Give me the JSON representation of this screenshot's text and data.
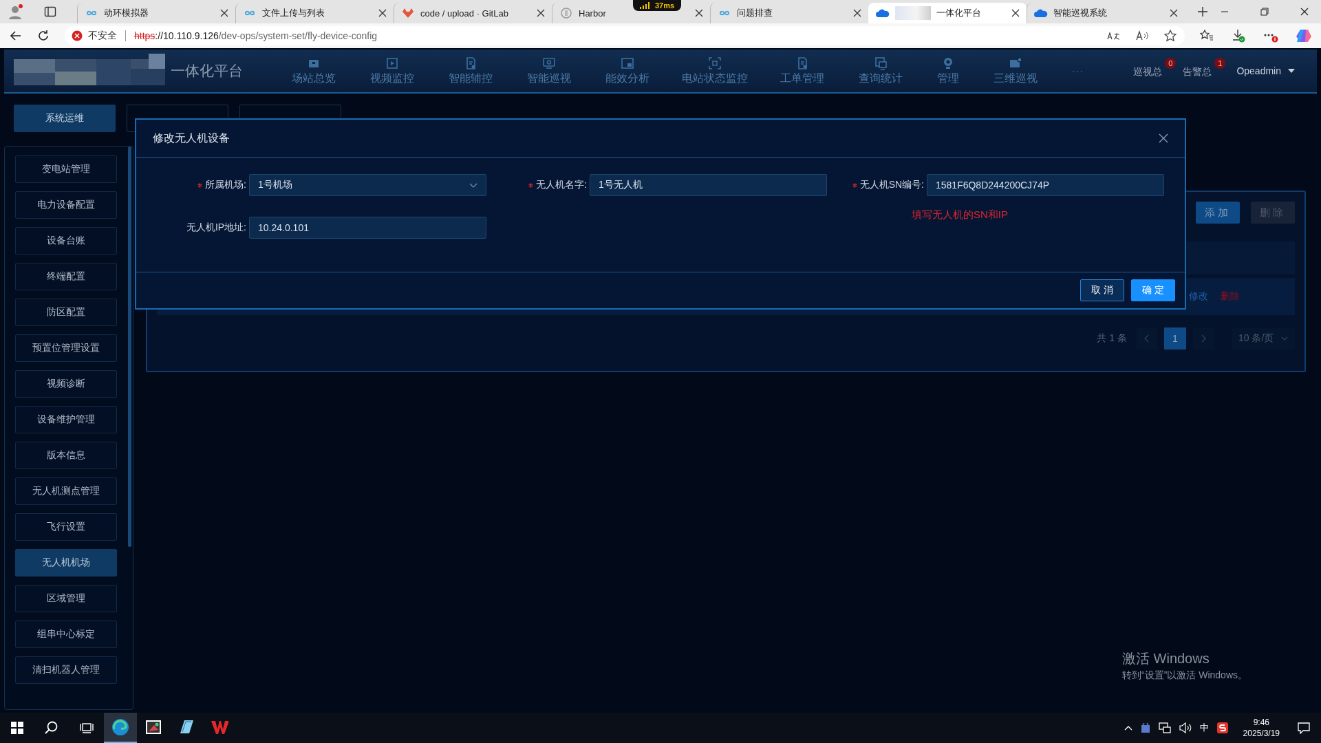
{
  "browser": {
    "tabs": [
      {
        "title": "动环模拟器",
        "kind": "loop",
        "selected": false
      },
      {
        "title": "文件上传与列表",
        "kind": "loop",
        "selected": false
      },
      {
        "title": "code / upload · GitLab",
        "kind": "fox",
        "selected": false
      },
      {
        "title": "Harbor",
        "kind": "circle",
        "selected": false
      },
      {
        "title": "问题排查",
        "kind": "loop",
        "selected": false
      },
      {
        "title": "一体化平台",
        "kind": "cloud",
        "selected": true
      },
      {
        "title": "智能巡视系统",
        "kind": "cloud",
        "selected": false
      }
    ],
    "latency": "37ms",
    "security": "不安全",
    "url": {
      "scheme": "https",
      "host": "://10.110.9.126",
      "path": "/dev-ops/system-set/fly-device-config"
    }
  },
  "header": {
    "title": "一体化平台",
    "nav": [
      {
        "label": "场站总览",
        "kind": "box"
      },
      {
        "label": "视频监控",
        "kind": "play"
      },
      {
        "label": "智能辅控",
        "kind": "doc"
      },
      {
        "label": "智能巡视",
        "kind": "screen"
      },
      {
        "label": "能效分析",
        "kind": "window"
      },
      {
        "label": "电站状态监控",
        "kind": "scan"
      },
      {
        "label": "工单管理",
        "kind": "doc"
      },
      {
        "label": "查询统计",
        "kind": "monitor"
      },
      {
        "label": "管理",
        "kind": "pin"
      },
      {
        "label": "三维巡视",
        "kind": "cam"
      }
    ],
    "more": "···",
    "counters": [
      {
        "label": "巡视总",
        "count": "0"
      },
      {
        "label": "告警总",
        "count": "1"
      }
    ],
    "user": "Opeadmin"
  },
  "top_tabs": [
    {
      "label": "系统运维",
      "selected": true
    },
    {
      "selected": false
    },
    {
      "selected": false
    }
  ],
  "sidebar": {
    "items": [
      {
        "label": "变电站管理",
        "selected": false
      },
      {
        "label": "电力设备配置",
        "selected": false
      },
      {
        "label": "设备台账",
        "selected": false
      },
      {
        "label": "终端配置",
        "selected": false
      },
      {
        "label": "防区配置",
        "selected": false
      },
      {
        "label": "预置位管理设置",
        "selected": false
      },
      {
        "label": "视频诊断",
        "selected": false
      },
      {
        "label": "设备维护管理",
        "selected": false
      },
      {
        "label": "版本信息",
        "selected": false
      },
      {
        "label": "无人机测点管理",
        "selected": false
      },
      {
        "label": "飞行设置",
        "selected": false
      },
      {
        "label": "无人机机场",
        "selected": true
      },
      {
        "label": "区域管理",
        "selected": false
      },
      {
        "label": "组串中心标定",
        "selected": false
      },
      {
        "label": "清扫机器人管理",
        "selected": false
      }
    ]
  },
  "panel": {
    "buttons": [
      {
        "label": "添加",
        "disabled": false
      },
      {
        "label": "删除",
        "disabled": true
      }
    ],
    "row_actions": [
      {
        "label": "修改",
        "kind": "edit"
      },
      {
        "label": "删除",
        "kind": "delete"
      }
    ],
    "pagination": {
      "total": "共 1 条",
      "pages": [
        {
          "label": "1",
          "selected": true
        }
      ],
      "page_size": "10 条/页"
    }
  },
  "dialog": {
    "title": "修改无人机设备",
    "fields": [
      {
        "label": "所属机场:",
        "required": true,
        "kind": "select",
        "value": "1号机场"
      },
      {
        "label": "无人机名字:",
        "required": true,
        "kind": "input",
        "value": "1号无人机"
      },
      {
        "label": "无人机SN编号:",
        "required": true,
        "kind": "input",
        "value": "1581F6Q8D244200CJ74P"
      },
      {
        "label": "无人机IP地址:",
        "required": false,
        "kind": "input",
        "value": "10.24.0.101"
      }
    ],
    "hint": "填写无人机的SN和IP",
    "buttons": [
      {
        "label": "取 消",
        "kind": "secondary"
      },
      {
        "label": "确 定",
        "kind": "primary"
      }
    ]
  },
  "os": {
    "watermark": {
      "title": "激活 Windows",
      "subtitle": "转到“设置”以激活 Windows。"
    },
    "taskbar_apps": [
      {
        "kind": "edge",
        "selected": true
      },
      {
        "kind": "paint",
        "selected": false
      },
      {
        "kind": "notes",
        "selected": false
      },
      {
        "kind": "office",
        "selected": false
      }
    ],
    "ime": "中",
    "time": "9:46",
    "date": "2025/3/19"
  }
}
